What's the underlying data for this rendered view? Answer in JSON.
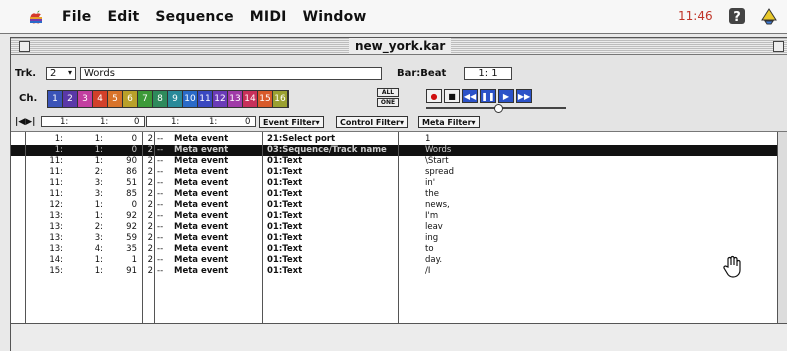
{
  "menubar": {
    "items": [
      "File",
      "Edit",
      "Sequence",
      "MIDI",
      "Window"
    ],
    "clock": "11:46",
    "apple_icon": "apple-icon",
    "help_icon": "help-icon",
    "app_icon": "application-icon"
  },
  "window": {
    "title": "new_york.kar"
  },
  "controls": {
    "track_label": "Trk.",
    "track_value": "2",
    "track_name": "Words",
    "bar_beat_label": "Bar:Beat",
    "bar_beat_value": "1:  1",
    "channel_label": "Ch.",
    "channels": [
      "1",
      "2",
      "3",
      "4",
      "5",
      "6",
      "7",
      "8",
      "9",
      "10",
      "11",
      "12",
      "13",
      "14",
      "15",
      "16"
    ],
    "channel_colors": [
      "#3a53b8",
      "#5a38a8",
      "#c23ea0",
      "#d2402a",
      "#d8732a",
      "#b9a12a",
      "#3c9a38",
      "#2e8a5c",
      "#2a8a9a",
      "#2a6ac8",
      "#3a48c0",
      "#6a3ab8",
      "#a03aa8",
      "#c8305a",
      "#d85a2a",
      "#9aa030"
    ],
    "all_label": "ALL",
    "one_label": "ONE",
    "position": [
      "1:",
      "1:",
      "0"
    ],
    "position_end": [
      "1:",
      "1:",
      "0"
    ],
    "event_filter": "Event Filter",
    "control_filter": "Control Filter",
    "meta_filter": "Meta Filter"
  },
  "events": [
    {
      "bar": "1:",
      "beat": "1:",
      "tick": "0",
      "ch": "2",
      "dash": "--",
      "type": "Meta event",
      "sub": "21:Select port",
      "data": "1",
      "selected": false
    },
    {
      "bar": "1:",
      "beat": "1:",
      "tick": "0",
      "ch": "2",
      "dash": "--",
      "type": "Meta event",
      "sub": "03:Sequence/Track name",
      "data": "Words",
      "selected": true
    },
    {
      "bar": "11:",
      "beat": "1:",
      "tick": "90",
      "ch": "2",
      "dash": "--",
      "type": "Meta event",
      "sub": "01:Text",
      "data": "\\Start",
      "selected": false
    },
    {
      "bar": "11:",
      "beat": "2:",
      "tick": "86",
      "ch": "2",
      "dash": "--",
      "type": "Meta event",
      "sub": "01:Text",
      "data": "spread",
      "selected": false
    },
    {
      "bar": "11:",
      "beat": "3:",
      "tick": "51",
      "ch": "2",
      "dash": "--",
      "type": "Meta event",
      "sub": "01:Text",
      "data": "in'",
      "selected": false
    },
    {
      "bar": "11:",
      "beat": "3:",
      "tick": "85",
      "ch": "2",
      "dash": "--",
      "type": "Meta event",
      "sub": "01:Text",
      "data": "the",
      "selected": false
    },
    {
      "bar": "12:",
      "beat": "1:",
      "tick": "0",
      "ch": "2",
      "dash": "--",
      "type": "Meta event",
      "sub": "01:Text",
      "data": "news,",
      "selected": false
    },
    {
      "bar": "13:",
      "beat": "1:",
      "tick": "92",
      "ch": "2",
      "dash": "--",
      "type": "Meta event",
      "sub": "01:Text",
      "data": "I'm",
      "selected": false
    },
    {
      "bar": "13:",
      "beat": "2:",
      "tick": "92",
      "ch": "2",
      "dash": "--",
      "type": "Meta event",
      "sub": "01:Text",
      "data": "leav",
      "selected": false
    },
    {
      "bar": "13:",
      "beat": "3:",
      "tick": "59",
      "ch": "2",
      "dash": "--",
      "type": "Meta event",
      "sub": "01:Text",
      "data": "ing",
      "selected": false
    },
    {
      "bar": "13:",
      "beat": "4:",
      "tick": "35",
      "ch": "2",
      "dash": "--",
      "type": "Meta event",
      "sub": "01:Text",
      "data": "to",
      "selected": false
    },
    {
      "bar": "14:",
      "beat": "1:",
      "tick": "1",
      "ch": "2",
      "dash": "--",
      "type": "Meta event",
      "sub": "01:Text",
      "data": "day.",
      "selected": false
    },
    {
      "bar": "15:",
      "beat": "1:",
      "tick": "91",
      "ch": "2",
      "dash": "--",
      "type": "Meta event",
      "sub": "01:Text",
      "data": "/I",
      "selected": false
    }
  ],
  "cursor_icon": "hand-cursor-icon"
}
